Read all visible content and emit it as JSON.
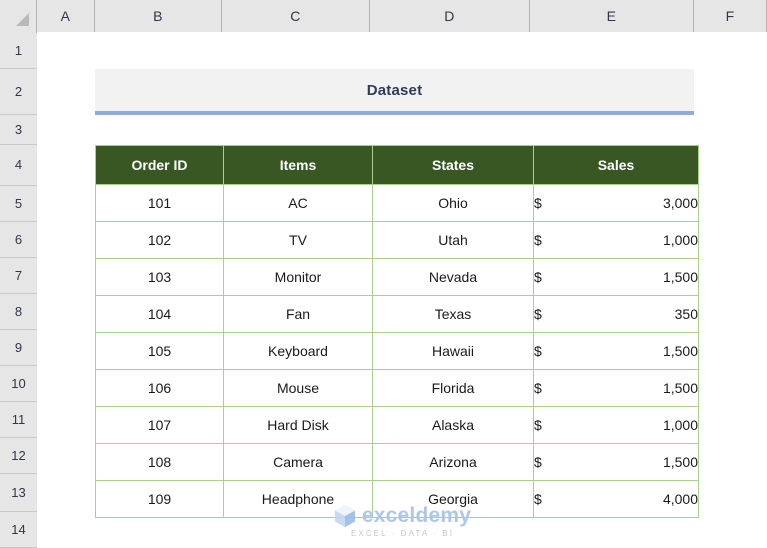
{
  "app": "excel-spreadsheet",
  "grid": {
    "column_headers": [
      "A",
      "B",
      "C",
      "D",
      "E",
      "F"
    ],
    "row_headers": [
      "1",
      "2",
      "3",
      "4",
      "5",
      "6",
      "7",
      "8",
      "9",
      "10",
      "11",
      "12",
      "13",
      "14"
    ],
    "select_all_icon": "select-all-triangle-icon"
  },
  "title_band": {
    "text": "Dataset",
    "background": "#f2f2f2",
    "text_color": "#2f3b57",
    "underline_color": "#8faadc"
  },
  "table": {
    "header_background": "#385723",
    "header_text_color": "#ffffff",
    "border_color": "#a9d08e",
    "columns": [
      "Order ID",
      "Items",
      "States",
      "Sales"
    ],
    "currency_symbol": "$",
    "rows": [
      {
        "order_id": "101",
        "item": "AC",
        "state": "Ohio",
        "sales": "3,000"
      },
      {
        "order_id": "102",
        "item": "TV",
        "state": "Utah",
        "sales": "1,000"
      },
      {
        "order_id": "103",
        "item": "Monitor",
        "state": "Nevada",
        "sales": "1,500"
      },
      {
        "order_id": "104",
        "item": "Fan",
        "state": "Texas",
        "sales": "350"
      },
      {
        "order_id": "105",
        "item": "Keyboard",
        "state": "Hawaii",
        "sales": "1,500"
      },
      {
        "order_id": "106",
        "item": "Mouse",
        "state": "Florida",
        "sales": "1,500"
      },
      {
        "order_id": "107",
        "item": "Hard Disk",
        "state": "Alaska",
        "sales": "1,000"
      },
      {
        "order_id": "108",
        "item": "Camera",
        "state": "Arizona",
        "sales": "1,500"
      },
      {
        "order_id": "109",
        "item": "Headphone",
        "state": "Georgia",
        "sales": "4,000"
      }
    ]
  },
  "watermark": {
    "logo_icon": "exceldemy-cube-logo-icon",
    "word": "exceldemy",
    "tagline": "EXCEL · DATA · BI",
    "color": "#a8c3e8"
  }
}
